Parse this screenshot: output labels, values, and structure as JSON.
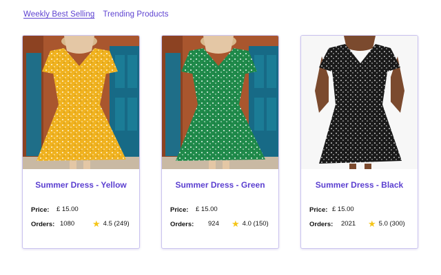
{
  "tabs": [
    {
      "label": "Weekly Best Selling",
      "active": true
    },
    {
      "label": "Trending Products",
      "active": false
    }
  ],
  "labels": {
    "price": "Price:",
    "orders": "Orders:"
  },
  "products": [
    {
      "title": "Summer Dress - Yellow",
      "price": "£ 15.00",
      "orders": "1080",
      "rating": "4.5 (249)",
      "dress_color": "#f0b21f",
      "background": "door-blue"
    },
    {
      "title": "Summer Dress - Green",
      "price": "£ 15.00",
      "orders": "924",
      "rating": "4.0 (150)",
      "dress_color": "#1f8a4a",
      "background": "door-blue"
    },
    {
      "title": "Summer Dress - Black",
      "price": "£ 15.00",
      "orders": "2021",
      "rating": "5.0 (300)",
      "dress_color": "#1a1a1a",
      "background": "plain-white"
    }
  ],
  "icons": {
    "star": "star-icon"
  },
  "colors": {
    "accent": "#5b3fd0",
    "star": "#f5c518",
    "card_border": "#c9c2ee"
  }
}
